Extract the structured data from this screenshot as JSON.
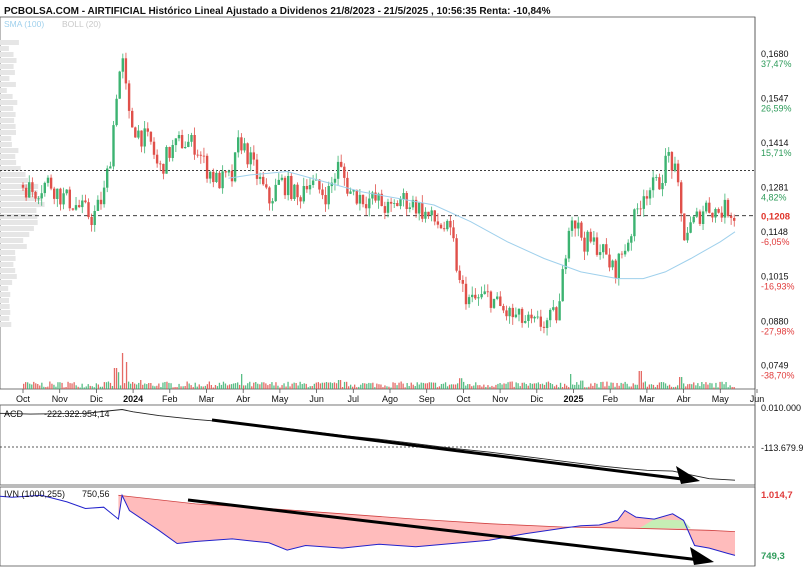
{
  "header": {
    "title": "PCBOLSA.COM - AIRTIFICIAL Histórico Lineal Ajustado a Dividenos 21/8/2023 - 21/5/2025 , 10:56:35 Renta: -10,84%",
    "sma_legend": "SMA (100)",
    "boll_legend": "BOLL (20)"
  },
  "colors": {
    "up": "#3cb371",
    "down": "#e0504a",
    "sma": "#9fd0ec",
    "pct_up": "#2e9b5a",
    "pct_down": "#e03b3b",
    "price_box": "#e0352b",
    "acd_line": "#222222",
    "ivn_line": "#2222cc",
    "ivn_fill_below": "#ffbcbc",
    "ivn_fill_above": "#c6eeb5",
    "arrow": "#000000"
  },
  "chart_data": [
    {
      "type": "candlestick",
      "title": "AIRTIFICIAL",
      "ylim": [
        0.069,
        0.179
      ],
      "y_ticks": [
        {
          "value": 0.168,
          "label": "0,1680",
          "pct": "37,47%"
        },
        {
          "value": 0.1547,
          "label": "0,1547",
          "pct": "26,59%"
        },
        {
          "value": 0.1414,
          "label": "0,1414",
          "pct": "15,71%"
        },
        {
          "value": 0.1281,
          "label": "0,1281",
          "pct": "4,82%"
        },
        {
          "value": 0.1148,
          "label": "0,1148",
          "pct": "-6,05%"
        },
        {
          "value": 0.1015,
          "label": "0,1015",
          "pct": "-16,93%"
        },
        {
          "value": 0.088,
          "label": "0,0880",
          "pct": "-27,98%"
        },
        {
          "value": 0.0749,
          "label": "0,0749",
          "pct": "-38,70%"
        }
      ],
      "current_price": {
        "value": 0.1208,
        "label": "0,1208"
      },
      "reference_line": 0.1343,
      "x_ticks": [
        {
          "t": 1.3,
          "label": "Oct",
          "bold": false
        },
        {
          "t": 2.3,
          "label": "Nov",
          "bold": false
        },
        {
          "t": 3.3,
          "label": "Dic",
          "bold": false
        },
        {
          "t": 4.3,
          "label": "2024",
          "bold": true
        },
        {
          "t": 5.3,
          "label": "Feb",
          "bold": false
        },
        {
          "t": 6.3,
          "label": "Mar",
          "bold": false
        },
        {
          "t": 7.3,
          "label": "Abr",
          "bold": false
        },
        {
          "t": 8.3,
          "label": "May",
          "bold": false
        },
        {
          "t": 9.3,
          "label": "Jun",
          "bold": false
        },
        {
          "t": 10.3,
          "label": "Jul",
          "bold": false
        },
        {
          "t": 11.3,
          "label": "Ago",
          "bold": false
        },
        {
          "t": 12.3,
          "label": "Sep",
          "bold": false
        },
        {
          "t": 13.3,
          "label": "Oct",
          "bold": false
        },
        {
          "t": 14.3,
          "label": "Nov",
          "bold": false
        },
        {
          "t": 15.3,
          "label": "Dic",
          "bold": false
        },
        {
          "t": 16.3,
          "label": "2025",
          "bold": true
        },
        {
          "t": 17.3,
          "label": "Feb",
          "bold": false
        },
        {
          "t": 18.3,
          "label": "Mar",
          "bold": false
        },
        {
          "t": 19.3,
          "label": "Abr",
          "bold": false
        },
        {
          "t": 20.3,
          "label": "May",
          "bold": false
        },
        {
          "t": 21.3,
          "label": "Jun",
          "bold": false
        }
      ],
      "price_path": [
        [
          0.0,
          0.128
        ],
        [
          0.3,
          0.123
        ],
        [
          0.6,
          0.127
        ],
        [
          1.0,
          0.124
        ],
        [
          1.3,
          0.13
        ],
        [
          1.6,
          0.128
        ],
        [
          2.0,
          0.131
        ],
        [
          2.3,
          0.127
        ],
        [
          2.6,
          0.125
        ],
        [
          3.0,
          0.122
        ],
        [
          3.2,
          0.12
        ],
        [
          3.5,
          0.127
        ],
        [
          3.7,
          0.14
        ],
        [
          3.85,
          0.158
        ],
        [
          4.0,
          0.168
        ],
        [
          4.2,
          0.149
        ],
        [
          4.5,
          0.145
        ],
        [
          4.8,
          0.142
        ],
        [
          5.0,
          0.134
        ],
        [
          5.3,
          0.14
        ],
        [
          5.6,
          0.143
        ],
        [
          6.0,
          0.142
        ],
        [
          6.3,
          0.135
        ],
        [
          6.6,
          0.131
        ],
        [
          7.0,
          0.132
        ],
        [
          7.2,
          0.144
        ],
        [
          7.5,
          0.137
        ],
        [
          7.8,
          0.13
        ],
        [
          8.0,
          0.125
        ],
        [
          8.3,
          0.131
        ],
        [
          8.6,
          0.129
        ],
        [
          8.8,
          0.125
        ],
        [
          9.0,
          0.132
        ],
        [
          9.3,
          0.129
        ],
        [
          9.6,
          0.127
        ],
        [
          9.9,
          0.136
        ],
        [
          10.2,
          0.128
        ],
        [
          10.6,
          0.126
        ],
        [
          11.0,
          0.125
        ],
        [
          11.3,
          0.122
        ],
        [
          11.6,
          0.126
        ],
        [
          12.0,
          0.124
        ],
        [
          12.4,
          0.12
        ],
        [
          12.8,
          0.117
        ],
        [
          13.0,
          0.114
        ],
        [
          13.2,
          0.1
        ],
        [
          13.5,
          0.095
        ],
        [
          14.0,
          0.097
        ],
        [
          14.4,
          0.092
        ],
        [
          14.8,
          0.09
        ],
        [
          15.2,
          0.088
        ],
        [
          15.6,
          0.089
        ],
        [
          15.9,
          0.092
        ],
        [
          16.2,
          0.122
        ],
        [
          16.6,
          0.113
        ],
        [
          17.0,
          0.112
        ],
        [
          17.4,
          0.104
        ],
        [
          17.8,
          0.114
        ],
        [
          18.2,
          0.128
        ],
        [
          18.6,
          0.13
        ],
        [
          18.9,
          0.139
        ],
        [
          19.1,
          0.132
        ],
        [
          19.3,
          0.115
        ],
        [
          19.6,
          0.119
        ],
        [
          19.9,
          0.124
        ],
        [
          20.2,
          0.122
        ],
        [
          20.5,
          0.123
        ],
        [
          20.7,
          0.121
        ]
      ],
      "sma_path": [
        [
          6.9,
          0.132
        ],
        [
          7.5,
          0.133
        ],
        [
          8.5,
          0.134
        ],
        [
          9.5,
          0.131
        ],
        [
          10.5,
          0.128
        ],
        [
          11.5,
          0.126
        ],
        [
          12.5,
          0.124
        ],
        [
          13.5,
          0.119
        ],
        [
          14.5,
          0.113
        ],
        [
          15.5,
          0.108
        ],
        [
          16.5,
          0.104
        ],
        [
          17.5,
          0.102
        ],
        [
          18.2,
          0.102
        ],
        [
          18.8,
          0.104
        ],
        [
          19.5,
          0.108
        ],
        [
          20.3,
          0.113
        ],
        [
          20.7,
          0.116
        ]
      ],
      "volume_spikes": [
        [
          3.9,
          0.28
        ],
        [
          4.0,
          0.6
        ],
        [
          4.1,
          0.45
        ],
        [
          3.8,
          0.35
        ],
        [
          7.25,
          0.25
        ],
        [
          13.2,
          0.18
        ],
        [
          16.2,
          0.25
        ],
        [
          18.1,
          0.3
        ],
        [
          19.2,
          0.2
        ],
        [
          4.5,
          0.15
        ],
        [
          9.9,
          0.15
        ],
        [
          2.5,
          0.12
        ],
        [
          16.5,
          0.14
        ],
        [
          14.5,
          0.1
        ]
      ]
    },
    {
      "type": "line",
      "title": "ACD",
      "value_label": "-222.322.954,14",
      "y_ticks": [
        {
          "label": "-113.679.9"
        }
      ],
      "top_label": "0.010.000",
      "path": [
        [
          0,
          0.06
        ],
        [
          1.5,
          0.08
        ],
        [
          3.0,
          0.07
        ],
        [
          3.6,
          0.04
        ],
        [
          4.0,
          0.02
        ],
        [
          4.3,
          0.05
        ],
        [
          5.0,
          0.1
        ],
        [
          6.0,
          0.15
        ],
        [
          7.0,
          0.19
        ],
        [
          8.0,
          0.24
        ],
        [
          9.0,
          0.3
        ],
        [
          10.0,
          0.36
        ],
        [
          11.0,
          0.41
        ],
        [
          12.0,
          0.47
        ],
        [
          13.0,
          0.53
        ],
        [
          14.0,
          0.58
        ],
        [
          15.0,
          0.64
        ],
        [
          16.0,
          0.7
        ],
        [
          17.0,
          0.76
        ],
        [
          17.8,
          0.8
        ],
        [
          18.3,
          0.82
        ],
        [
          19.0,
          0.83
        ],
        [
          19.5,
          0.88
        ],
        [
          20.0,
          0.93
        ],
        [
          20.7,
          0.95
        ]
      ]
    },
    {
      "type": "area",
      "title": "IVN (1000,255)",
      "value_label": "750,56",
      "y_ticks": [
        {
          "label": "1.014,7",
          "color": "red"
        },
        {
          "label": "749,3",
          "color": "green"
        }
      ],
      "ivn_path": [
        [
          0,
          0.0
        ],
        [
          1.0,
          0.05
        ],
        [
          1.8,
          0.02
        ],
        [
          2.5,
          0.12
        ],
        [
          3.0,
          0.22
        ],
        [
          3.5,
          0.2
        ],
        [
          3.9,
          0.38
        ],
        [
          4.0,
          0.02
        ],
        [
          4.2,
          0.25
        ],
        [
          5.0,
          0.55
        ],
        [
          5.5,
          0.75
        ],
        [
          6.0,
          0.72
        ],
        [
          7.0,
          0.68
        ],
        [
          8.0,
          0.74
        ],
        [
          8.5,
          0.85
        ],
        [
          9.0,
          0.78
        ],
        [
          10.0,
          0.82
        ],
        [
          11.0,
          0.76
        ],
        [
          12.0,
          0.8
        ],
        [
          13.0,
          0.75
        ],
        [
          14.0,
          0.7
        ],
        [
          15.0,
          0.6
        ],
        [
          16.0,
          0.52
        ],
        [
          16.5,
          0.48
        ],
        [
          17.0,
          0.47
        ],
        [
          17.5,
          0.4
        ],
        [
          17.7,
          0.25
        ],
        [
          18.0,
          0.35
        ],
        [
          18.5,
          0.38
        ],
        [
          19.0,
          0.3
        ],
        [
          19.3,
          0.4
        ],
        [
          19.6,
          0.78
        ],
        [
          20.0,
          0.82
        ],
        [
          20.5,
          0.9
        ],
        [
          20.7,
          0.93
        ]
      ],
      "ivn_ma_path": [
        [
          3.9,
          0.02
        ],
        [
          6.0,
          0.15
        ],
        [
          8.0,
          0.22
        ],
        [
          10.0,
          0.3
        ],
        [
          12.0,
          0.38
        ],
        [
          14.0,
          0.45
        ],
        [
          16.0,
          0.5
        ],
        [
          18.0,
          0.52
        ],
        [
          20.0,
          0.55
        ],
        [
          20.7,
          0.57
        ]
      ]
    }
  ]
}
